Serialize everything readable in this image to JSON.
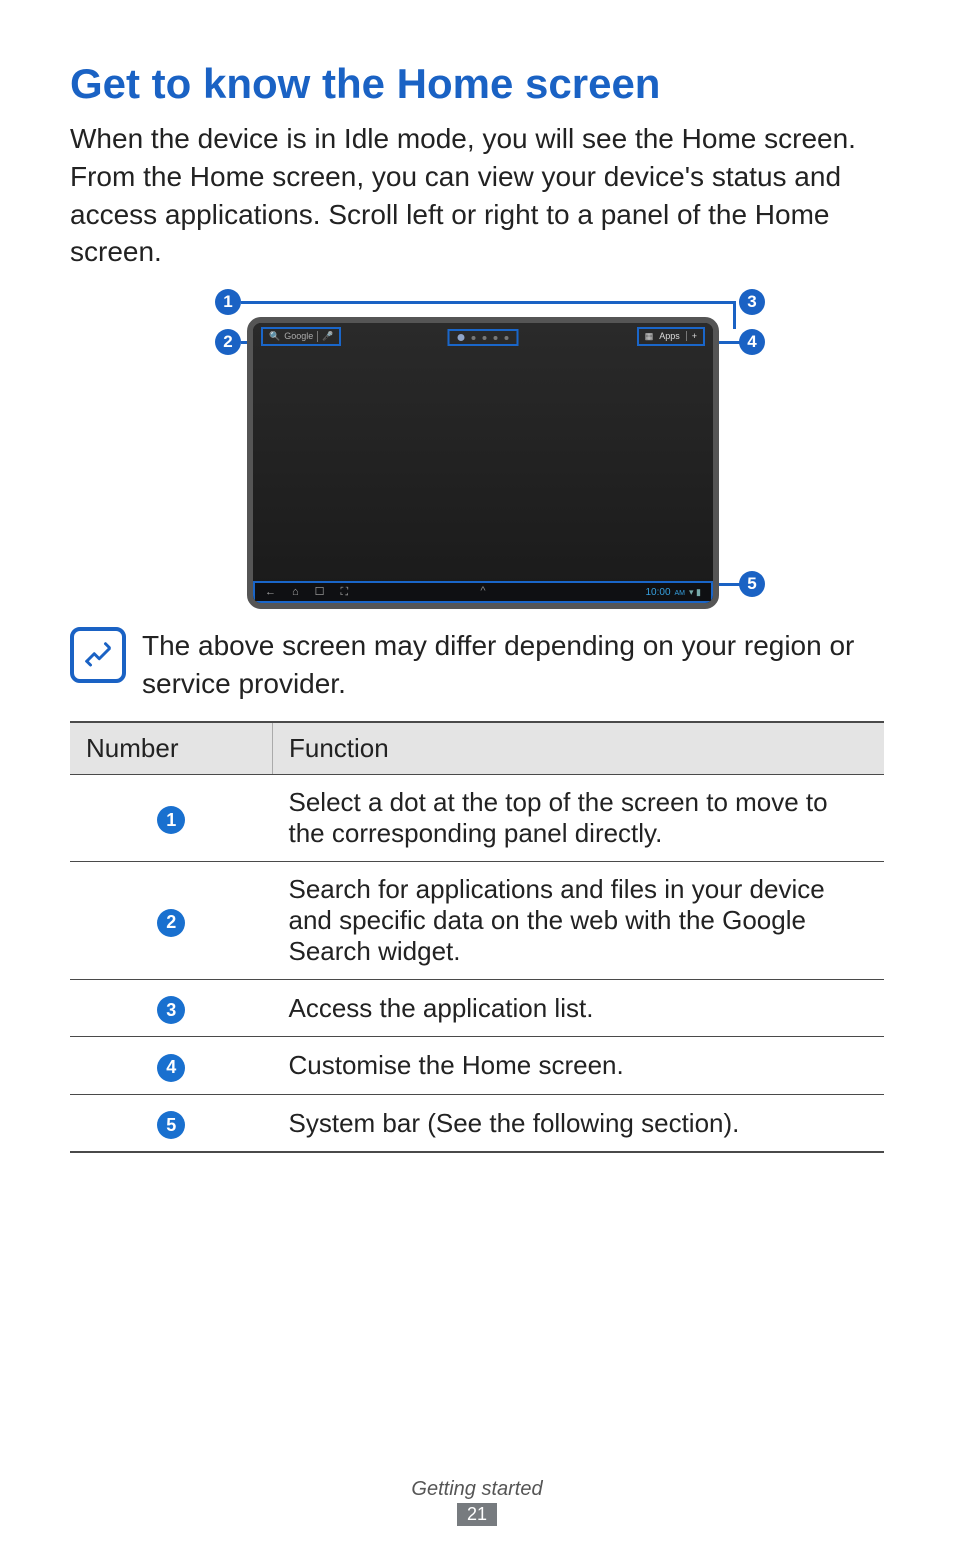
{
  "title": "Get to know the Home screen",
  "intro": "When the device is in Idle mode, you will see the Home screen. From the Home screen, you can view your device's status and access applications. Scroll left or right to a panel of the Home screen.",
  "diagram": {
    "callouts": {
      "c1": "1",
      "c2": "2",
      "c3": "3",
      "c4": "4",
      "c5": "5"
    },
    "search_label": "Google",
    "apps_label": "Apps",
    "apps_plus": "+",
    "clock": "10:00",
    "clock_suffix": "AM",
    "nav": {
      "back": "←",
      "home": "⌂",
      "recent": "☐",
      "capture": "⛶"
    },
    "caret": "^",
    "indicators": "▾ ▮"
  },
  "note": "The above screen may differ depending on your region or service provider.",
  "table": {
    "headers": {
      "number": "Number",
      "function": "Function"
    },
    "rows": [
      {
        "num": "1",
        "func": "Select a dot at the top of the screen to move to the corresponding panel directly."
      },
      {
        "num": "2",
        "func": "Search for applications and files in your device and specific data on the web with the Google Search widget."
      },
      {
        "num": "3",
        "func": "Access the application list."
      },
      {
        "num": "4",
        "func": "Customise the Home screen."
      },
      {
        "num": "5",
        "func": "System bar (See the following section)."
      }
    ]
  },
  "footer": {
    "section": "Getting started",
    "page": "21"
  }
}
